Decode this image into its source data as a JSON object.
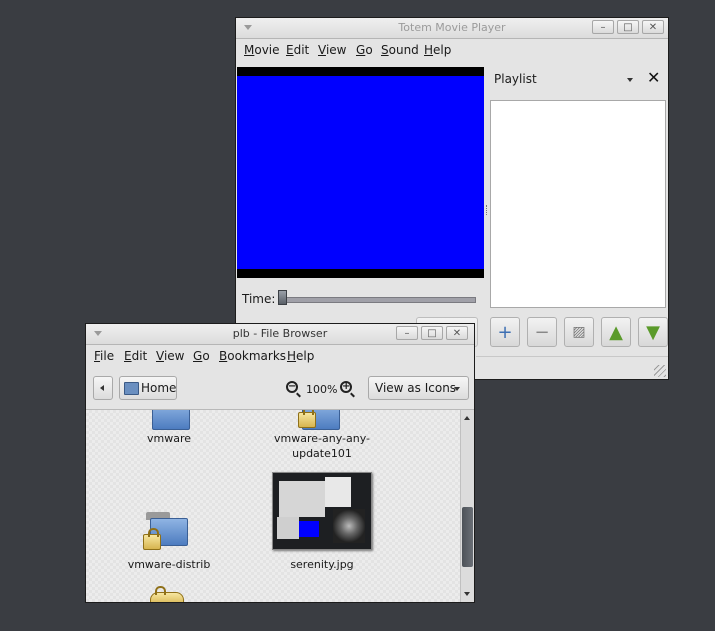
{
  "totem": {
    "title": "Totem Movie Player",
    "menu": [
      "Movie",
      "Edit",
      "View",
      "Go",
      "Sound",
      "Help"
    ],
    "time_label": "Time:",
    "playlist_label": "Playlist",
    "colors": {
      "video": "#0000ff"
    }
  },
  "file_browser": {
    "title": "plb - File Browser",
    "menu": [
      "File",
      "Edit",
      "View",
      "Go",
      "Bookmarks",
      "Help"
    ],
    "home_label": "Home",
    "zoom_level": "100%",
    "view_mode": "View as Icons",
    "items": [
      {
        "label": "vmware",
        "icon": "folder-icon"
      },
      {
        "label": "vmware-any-any-update101",
        "line1": "vmware-any-any-",
        "line2": "update101",
        "icon": "locked-folder-icon"
      },
      {
        "label": "vmware-distrib",
        "icon": "locked-folder-icon"
      },
      {
        "label": "serenity.jpg",
        "icon": "image-thumbnail"
      }
    ]
  },
  "icons": [
    "minimize-icon",
    "maximize-icon",
    "close-icon",
    "back-arrow-icon",
    "home-icon",
    "zoom-out-icon",
    "zoom-in-icon",
    "add-icon",
    "remove-icon",
    "save-icon",
    "up-icon",
    "down-icon"
  ]
}
